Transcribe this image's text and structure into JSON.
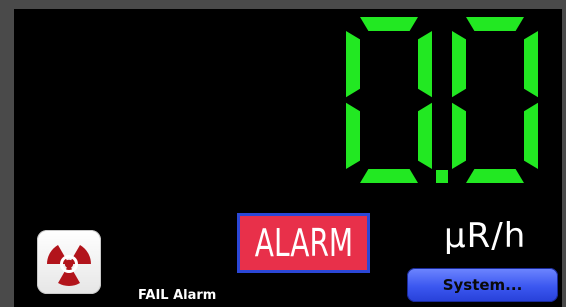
{
  "reading": {
    "digits": [
      "0",
      "0"
    ],
    "decimal_point": ".",
    "value_text": "0.0",
    "unit": "μR/h",
    "digit_color": "#22e822"
  },
  "alarm": {
    "label": "ALARM",
    "background_color": "#e8304a",
    "border_color": "#2b47d6"
  },
  "status": {
    "fail_label": "FAIL Alarm"
  },
  "buttons": {
    "radiation_icon": "radiation-trefoil-icon",
    "system_label": "System..."
  },
  "colors": {
    "screen_background": "#000000",
    "button_accent": "#3b57f0",
    "trefoil_red": "#b2141b"
  }
}
